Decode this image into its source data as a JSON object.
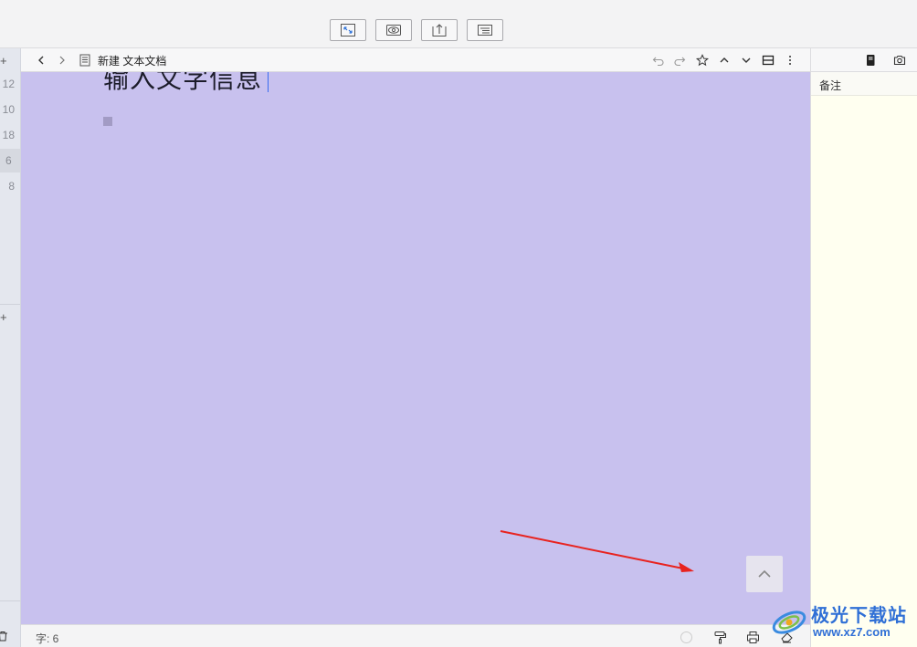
{
  "toolbar": {
    "buttons": [
      {
        "icon": "expand-icon"
      },
      {
        "icon": "eye-icon"
      },
      {
        "icon": "export-icon"
      },
      {
        "icon": "outline-icon"
      }
    ]
  },
  "left_strip": {
    "numbers": [
      "12",
      "10",
      "18",
      "6",
      "8"
    ],
    "active_index": 3,
    "plus": "+"
  },
  "document": {
    "title": "新建 文本文档",
    "heading": "输入文字信息"
  },
  "status": {
    "word_count": "字: 6"
  },
  "right_panel": {
    "tab_label": "备注"
  },
  "watermark": {
    "name": "极光下载站",
    "url": "www.xz7.com"
  },
  "colors": {
    "editor_bg": "#c8c1ee",
    "notes_bg": "#fffff0",
    "arrow": "#e8231f",
    "watermark": "#2f6fd6"
  }
}
